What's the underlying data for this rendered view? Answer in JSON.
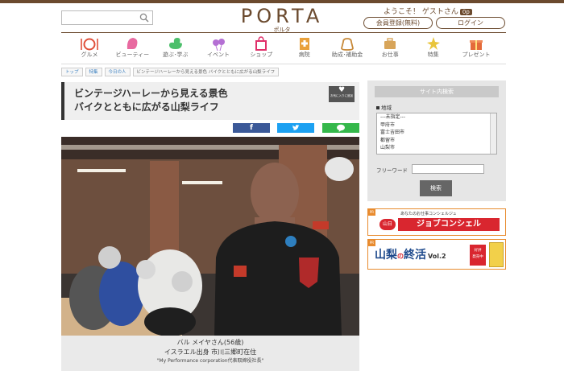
{
  "header": {
    "logo": "PORTA",
    "logo_sub": "ポルタ",
    "welcome": "ようこそ！ ゲストさん",
    "welcome_badge": "0p",
    "register_label": "会員登録(無料)",
    "login_label": "ログイン"
  },
  "nav": {
    "items": [
      {
        "label": "グルメ",
        "icon": "gourmet-icon"
      },
      {
        "label": "ビューティー",
        "icon": "beauty-icon"
      },
      {
        "label": "遊ぶ･学ぶ",
        "icon": "play-learn-icon"
      },
      {
        "label": "イベント",
        "icon": "event-icon"
      },
      {
        "label": "ショップ",
        "icon": "shop-icon"
      },
      {
        "label": "病院",
        "icon": "hospital-icon"
      },
      {
        "label": "助成･補助金",
        "icon": "subsidy-icon"
      },
      {
        "label": "お仕事",
        "icon": "job-icon"
      },
      {
        "label": "特集",
        "icon": "feature-icon"
      },
      {
        "label": "プレゼント",
        "icon": "present-icon"
      }
    ]
  },
  "breadcrumb": [
    "トップ",
    "特集",
    "今日の人",
    "ビンテージハーレーから見える景色 バイクとともに広がる山梨ライフ"
  ],
  "article": {
    "title_line1": "ビンテージハーレーから見える景色",
    "title_line2": "バイクとともに広がる山梨ライフ",
    "fav_label": "お気に入りに追加",
    "share": {
      "facebook": "f",
      "twitter": "twitter-icon",
      "line": "line-icon"
    },
    "caption_name": "バル メイヤさん(56歳)",
    "caption_origin": "イスラエル出身 市川三郷町在住",
    "caption_company": "\"My Performance corporation代表取締役社長\""
  },
  "sidebar": {
    "heading": "サイト内検索",
    "area_label": "地域",
    "area_options": [
      "---未指定---",
      "甲府市",
      "富士吉田市",
      "都留市",
      "山梨市"
    ],
    "freeword_label": "フリーワード",
    "freeword_value": "",
    "search_button": "検索"
  },
  "banners": {
    "job_small": "あなたのお仕事コンシェルジュ",
    "job_title": "ジョブコンシェル",
    "job_brand": "山日",
    "shukatsu_title_a": "山梨",
    "shukatsu_title_b": "の",
    "shukatsu_title_c": "終活",
    "shukatsu_vol": "Vol.2",
    "shukatsu_badge_1": "好評",
    "shukatsu_badge_2": "発売中",
    "tag": "PR"
  },
  "colors": {
    "brand": "#6b4a2e",
    "facebook": "#3b5998",
    "twitter": "#1da1f2",
    "line": "#35b84b",
    "banner_red": "#d9262f",
    "banner_orange": "#e88b2e"
  }
}
